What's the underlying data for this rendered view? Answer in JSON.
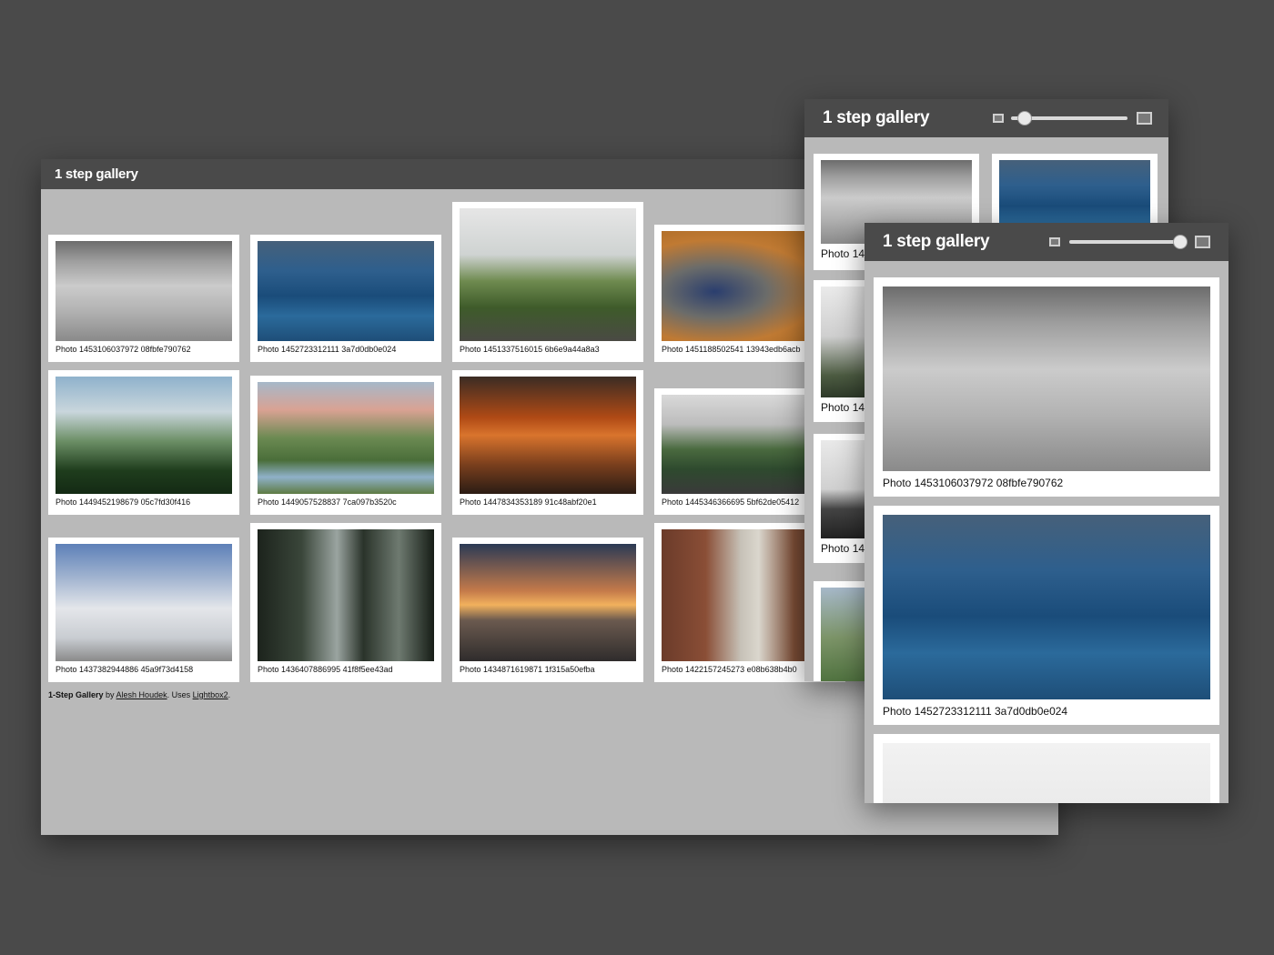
{
  "main_window": {
    "title": "1 step gallery",
    "photos": [
      {
        "caption": "Photo 1453106037972 08fbfe790762",
        "image": "wall"
      },
      {
        "caption": "Photo 1452723312111 3a7d0db0e024",
        "image": "wave"
      },
      {
        "caption": "Photo 1451337516015 6b6e9a44a8a3",
        "image": "cliff"
      },
      {
        "caption": "Photo 1451188502541 13943edb6acb",
        "image": "crater"
      },
      {
        "caption": "Photo 1449452198679 05c7fd30f416",
        "image": "castle"
      },
      {
        "caption": "Photo 1449057528837 7ca097b3520c",
        "image": "lake"
      },
      {
        "caption": "Photo 1447834353189 91c48abf20e1",
        "image": "canyon"
      },
      {
        "caption": "Photo 1445346366695 5bf62de05412",
        "image": "park"
      },
      {
        "caption": "Photo 1437382944886 45a9f73d4158",
        "image": "snow"
      },
      {
        "caption": "Photo 1436407886995 41f8f5ee43ad",
        "image": "forest"
      },
      {
        "caption": "Photo 1434871619871 1f315a50efba",
        "image": "rail"
      },
      {
        "caption": "Photo 1422157245273 e08b638b4b0",
        "image": "alley"
      }
    ],
    "footer": {
      "brand": "1-Step Gallery",
      "by": " by ",
      "author": "Alesh Houdek",
      "uses": ". Uses ",
      "lib": "Lightbox2",
      "end": "."
    }
  },
  "mid_window": {
    "title": "1 step gallery",
    "captions": [
      "Photo 14",
      "Photo 14",
      "Photo 14"
    ],
    "slider_level": 0.12
  },
  "front_window": {
    "title": "1 step gallery",
    "slider_level": 0.95,
    "photos": [
      {
        "caption": "Photo 1453106037972 08fbfe790762",
        "image": "wall"
      },
      {
        "caption": "Photo 1452723312111 3a7d0db0e024",
        "image": "wave"
      }
    ]
  },
  "colors": {
    "background": "#4a4a4a",
    "window_header": "#4a4a4a",
    "window_body": "#b9b9b9",
    "card": "#ffffff"
  }
}
